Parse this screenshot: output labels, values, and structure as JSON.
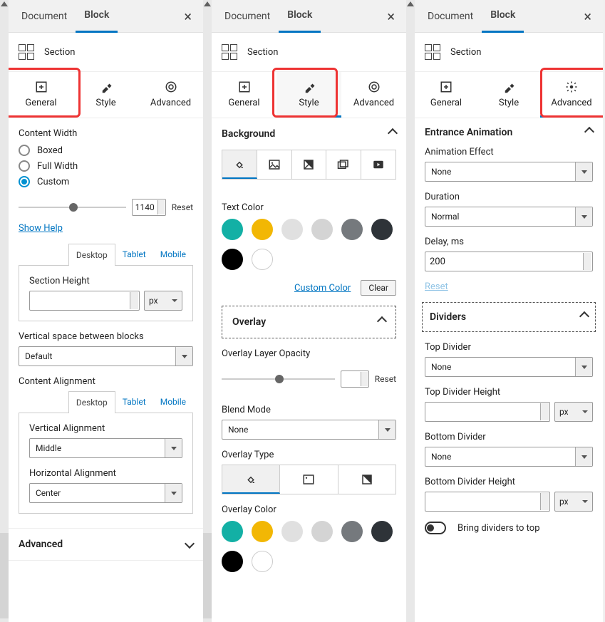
{
  "tabs": {
    "document": "Document",
    "block": "Block"
  },
  "section_label": "Section",
  "subtabs": {
    "general": "General",
    "style": "Style",
    "advanced": "Advanced"
  },
  "panel1": {
    "content_width": "Content Width",
    "boxed": "Boxed",
    "full": "Full Width",
    "custom": "Custom",
    "width_val": "1140",
    "reset": "Reset",
    "show_help": "Show Help",
    "desktop": "Desktop",
    "tablet": "Tablet",
    "mobile": "Mobile",
    "section_height": "Section Height",
    "px": "px",
    "vspace": "Vertical space between blocks",
    "vspace_val": "Default",
    "content_align": "Content Alignment",
    "valign": "Vertical Alignment",
    "valign_val": "Middle",
    "halign": "Horizontal Alignment",
    "halign_val": "Center",
    "advanced": "Advanced"
  },
  "panel2": {
    "background": "Background",
    "text_color": "Text Color",
    "custom_color": "Custom Color",
    "clear": "Clear",
    "overlay": "Overlay",
    "ov_opacity": "Overlay Layer Opacity",
    "reset": "Reset",
    "blend": "Blend Mode",
    "blend_val": "None",
    "ov_type": "Overlay Type",
    "ov_color": "Overlay Color",
    "colors": {
      "teal": "#13b0a5",
      "gold": "#f2b704",
      "lgray": "#e0e0e0",
      "lgray2": "#d4d4d4",
      "gray": "#75797d",
      "dark": "#2e3338",
      "black": "#000000"
    }
  },
  "panel3": {
    "entrance": "Entrance Animation",
    "effect": "Animation Effect",
    "effect_val": "None",
    "duration": "Duration",
    "duration_val": "Normal",
    "delay": "Delay, ms",
    "delay_val": "200",
    "reset": "Reset",
    "dividers": "Dividers",
    "top_div": "Top Divider",
    "top_val": "None",
    "top_h": "Top Divider Height",
    "px": "px",
    "bot_div": "Bottom Divider",
    "bot_val": "None",
    "bot_h": "Bottom Divider Height",
    "bring": "Bring dividers to top"
  }
}
